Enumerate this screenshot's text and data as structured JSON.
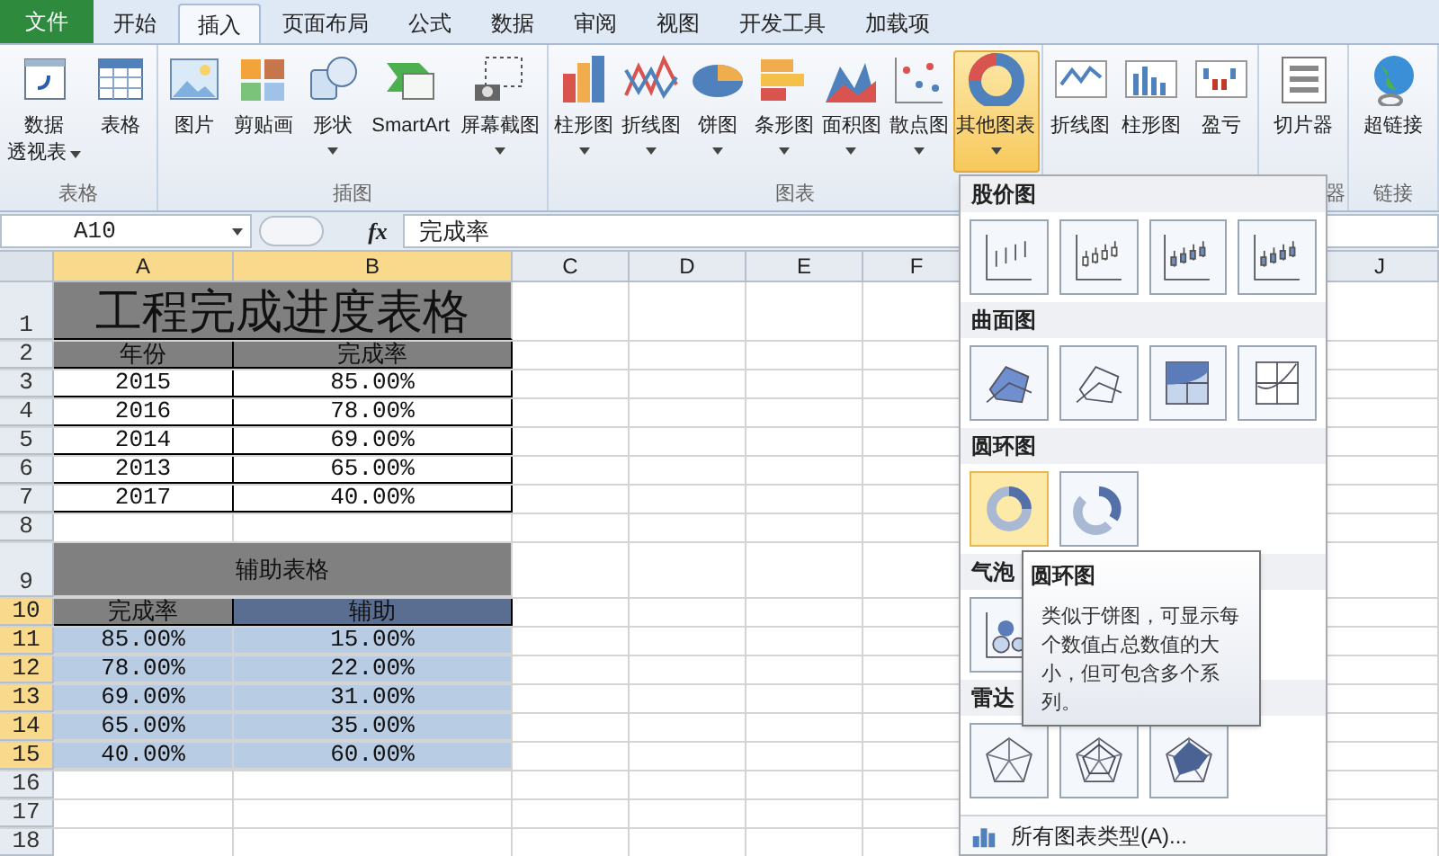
{
  "tabs": [
    {
      "label": "文件",
      "kind": "file",
      "selected": false
    },
    {
      "label": "开始",
      "kind": "tab",
      "selected": false
    },
    {
      "label": "插入",
      "kind": "tab",
      "selected": true
    },
    {
      "label": "页面布局",
      "kind": "tab",
      "selected": false
    },
    {
      "label": "公式",
      "kind": "tab",
      "selected": false
    },
    {
      "label": "数据",
      "kind": "tab",
      "selected": false
    },
    {
      "label": "审阅",
      "kind": "tab",
      "selected": false
    },
    {
      "label": "视图",
      "kind": "tab",
      "selected": false
    },
    {
      "label": "开发工具",
      "kind": "tab",
      "selected": false
    },
    {
      "label": "加载项",
      "kind": "tab",
      "selected": false
    }
  ],
  "ribbon": {
    "groups": [
      {
        "label": "表格",
        "buttons": [
          {
            "lines": [
              "数据",
              "透视表"
            ],
            "dropdown": true,
            "selected": false
          },
          {
            "lines": [
              "表格"
            ],
            "dropdown": false,
            "selected": false
          }
        ]
      },
      {
        "label": "插图",
        "buttons": [
          {
            "lines": [
              "图片"
            ],
            "dropdown": false,
            "selected": false
          },
          {
            "lines": [
              "剪贴画"
            ],
            "dropdown": false,
            "selected": false
          },
          {
            "lines": [
              "形状"
            ],
            "dropdown": true,
            "selected": false
          },
          {
            "lines": [
              "SmartArt"
            ],
            "dropdown": false,
            "selected": false
          },
          {
            "lines": [
              "屏幕截图"
            ],
            "dropdown": true,
            "selected": false
          }
        ]
      },
      {
        "label": "图表",
        "buttons": [
          {
            "lines": [
              "柱形图"
            ],
            "dropdown": true,
            "selected": false
          },
          {
            "lines": [
              "折线图"
            ],
            "dropdown": true,
            "selected": false
          },
          {
            "lines": [
              "饼图"
            ],
            "dropdown": true,
            "selected": false
          },
          {
            "lines": [
              "条形图"
            ],
            "dropdown": true,
            "selected": false
          },
          {
            "lines": [
              "面积图"
            ],
            "dropdown": true,
            "selected": false
          },
          {
            "lines": [
              "散点图"
            ],
            "dropdown": true,
            "selected": false
          },
          {
            "lines": [
              "其他图表"
            ],
            "dropdown": true,
            "selected": true
          }
        ]
      },
      {
        "buttons": [
          {
            "lines": [
              "折线图"
            ],
            "dropdown": false,
            "selected": false
          },
          {
            "lines": [
              "柱形图"
            ],
            "dropdown": false,
            "selected": false
          },
          {
            "lines": [
              "盈亏"
            ],
            "dropdown": false,
            "selected": false
          }
        ]
      },
      {
        "label": "器",
        "buttons": [
          {
            "lines": [
              "切片器"
            ],
            "dropdown": false,
            "selected": false
          }
        ]
      },
      {
        "label": "链接",
        "buttons": [
          {
            "lines": [
              "超链接"
            ],
            "dropdown": false,
            "selected": false
          }
        ]
      }
    ]
  },
  "formula_bar": {
    "name_box": "A10",
    "fx": "fx",
    "value": "完成率"
  },
  "columns": [
    {
      "label": "A",
      "selected": true
    },
    {
      "label": "B",
      "selected": true
    },
    {
      "label": "C",
      "selected": false
    },
    {
      "label": "D",
      "selected": false
    },
    {
      "label": "E",
      "selected": false
    },
    {
      "label": "F",
      "selected": false
    },
    {
      "label": "J",
      "selected": false
    }
  ],
  "rows": [
    {
      "number": "1",
      "selected": false,
      "kind": "title",
      "text": "工程完成进度表格"
    },
    {
      "number": "2",
      "selected": false,
      "kind": "header",
      "cells": [
        "年份",
        "完成率"
      ]
    },
    {
      "number": "3",
      "selected": false,
      "kind": "data",
      "cells": [
        "2015",
        "85.00%"
      ]
    },
    {
      "number": "4",
      "selected": false,
      "kind": "data",
      "cells": [
        "2016",
        "78.00%"
      ]
    },
    {
      "number": "5",
      "selected": false,
      "kind": "data",
      "cells": [
        "2014",
        "69.00%"
      ]
    },
    {
      "number": "6",
      "selected": false,
      "kind": "data",
      "cells": [
        "2013",
        "65.00%"
      ]
    },
    {
      "number": "7",
      "selected": false,
      "kind": "data",
      "cells": [
        "2017",
        "40.00%"
      ]
    },
    {
      "number": "8",
      "selected": false,
      "kind": "blank"
    },
    {
      "number": "9",
      "selected": false,
      "kind": "subtitle",
      "text": "辅助表格"
    },
    {
      "number": "10",
      "selected": true,
      "kind": "header2",
      "cells": [
        "完成率",
        "辅助"
      ]
    },
    {
      "number": "11",
      "selected": true,
      "kind": "sel",
      "cells": [
        "85.00%",
        "15.00%"
      ]
    },
    {
      "number": "12",
      "selected": true,
      "kind": "sel",
      "cells": [
        "78.00%",
        "22.00%"
      ]
    },
    {
      "number": "13",
      "selected": true,
      "kind": "sel",
      "cells": [
        "69.00%",
        "31.00%"
      ]
    },
    {
      "number": "14",
      "selected": true,
      "kind": "sel",
      "cells": [
        "65.00%",
        "35.00%"
      ]
    },
    {
      "number": "15",
      "selected": true,
      "kind": "sel",
      "cells": [
        "40.00%",
        "60.00%"
      ]
    },
    {
      "number": "16",
      "selected": false,
      "kind": "blank"
    },
    {
      "number": "17",
      "selected": false,
      "kind": "blank"
    },
    {
      "number": "18",
      "selected": false,
      "kind": "blank"
    }
  ],
  "chart_menu": {
    "sections": [
      {
        "title": "股价图",
        "items": [
          {
            "selected": false
          },
          {
            "selected": false
          },
          {
            "selected": false
          },
          {
            "selected": false
          }
        ]
      },
      {
        "title": "曲面图",
        "items": [
          {
            "selected": false
          },
          {
            "selected": false
          },
          {
            "selected": false
          },
          {
            "selected": false
          }
        ]
      },
      {
        "title": "圆环图",
        "items": [
          {
            "selected": true
          },
          {
            "selected": false
          }
        ]
      },
      {
        "title": "气泡",
        "items": [
          {
            "selected": false
          }
        ]
      },
      {
        "title": "雷达",
        "items": [
          {
            "selected": false
          },
          {
            "selected": false
          },
          {
            "selected": false
          }
        ]
      }
    ],
    "footer": "所有图表类型(A)..."
  },
  "tooltip": {
    "title": "圆环图",
    "text": "类似于饼图，可显示每个数值占总数值的大小，但可包含多个系列。"
  }
}
